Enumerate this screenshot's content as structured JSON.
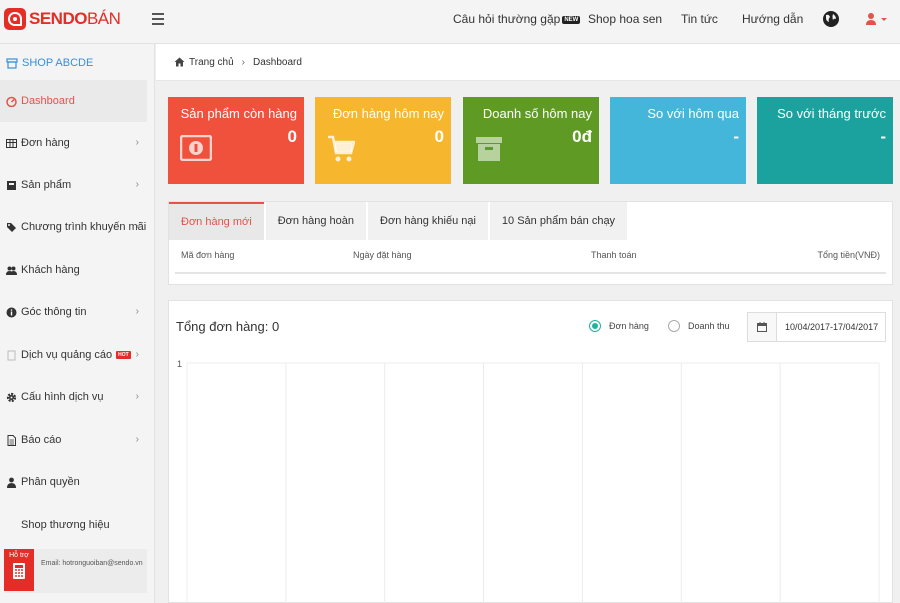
{
  "brand": {
    "name_bold": "SENDO",
    "name_thin": "BÁN"
  },
  "topnav": {
    "faq": "Câu hỏi thường gặp",
    "faq_badge": "NEW",
    "shop_hoa_sen": "Shop hoa sen",
    "news": "Tin tức",
    "guide": "Hướng dẫn"
  },
  "sidebar": {
    "shop_name": "SHOP ABCDE",
    "items": [
      {
        "label": "Dashboard"
      },
      {
        "label": "Đơn hàng"
      },
      {
        "label": "Sản phẩm"
      },
      {
        "label": "Chương trình khuyến mãi"
      },
      {
        "label": "Khách hàng"
      },
      {
        "label": "Góc thông tin"
      },
      {
        "label": "Dịch vụ quảng cáo",
        "badge": "HOT"
      },
      {
        "label": "Cấu hình dịch vụ"
      },
      {
        "label": "Báo cáo"
      },
      {
        "label": "Phân quyền"
      },
      {
        "label": "Shop thương hiệu"
      }
    ],
    "support_label": "Hỗ trợ",
    "support_email": "Email: hotronguoiban@sendo.vn"
  },
  "breadcrumb": {
    "home": "Trang chủ",
    "current": "Dashboard"
  },
  "cards": [
    {
      "title": "Sản phẩm còn hàng",
      "value": "0",
      "color": "#f0513c"
    },
    {
      "title": "Đơn hàng hôm nay",
      "value": "0",
      "color": "#f6b62d"
    },
    {
      "title": "Doanh số hôm nay",
      "value": "0đ",
      "color": "#5f9b24"
    },
    {
      "title": "So với hôm qua",
      "value": "-",
      "color": "#43b6d9"
    },
    {
      "title": "So với tháng trước",
      "value": "-",
      "color": "#1ba29f"
    }
  ],
  "tabs": [
    "Đơn hàng mới",
    "Đơn hàng hoàn",
    "Đơn hàng khiếu nại",
    "10 Sản phẩm bán chạy"
  ],
  "table": {
    "headers": [
      "Mã đơn hàng",
      "Ngày đặt hàng",
      "Thanh toán",
      "Tổng tiền(VNĐ)"
    ]
  },
  "stats": {
    "total_label": "Tổng đơn hàng: 0",
    "radio_orders": "Đơn hàng",
    "radio_revenue": "Doanh thu",
    "date_range": "10/04/2017-17/04/2017"
  },
  "chart_data": {
    "type": "line",
    "y_tick_labels": [
      "1"
    ],
    "ylim": [
      0,
      1
    ],
    "grid": true,
    "series": [
      {
        "values": []
      }
    ]
  }
}
